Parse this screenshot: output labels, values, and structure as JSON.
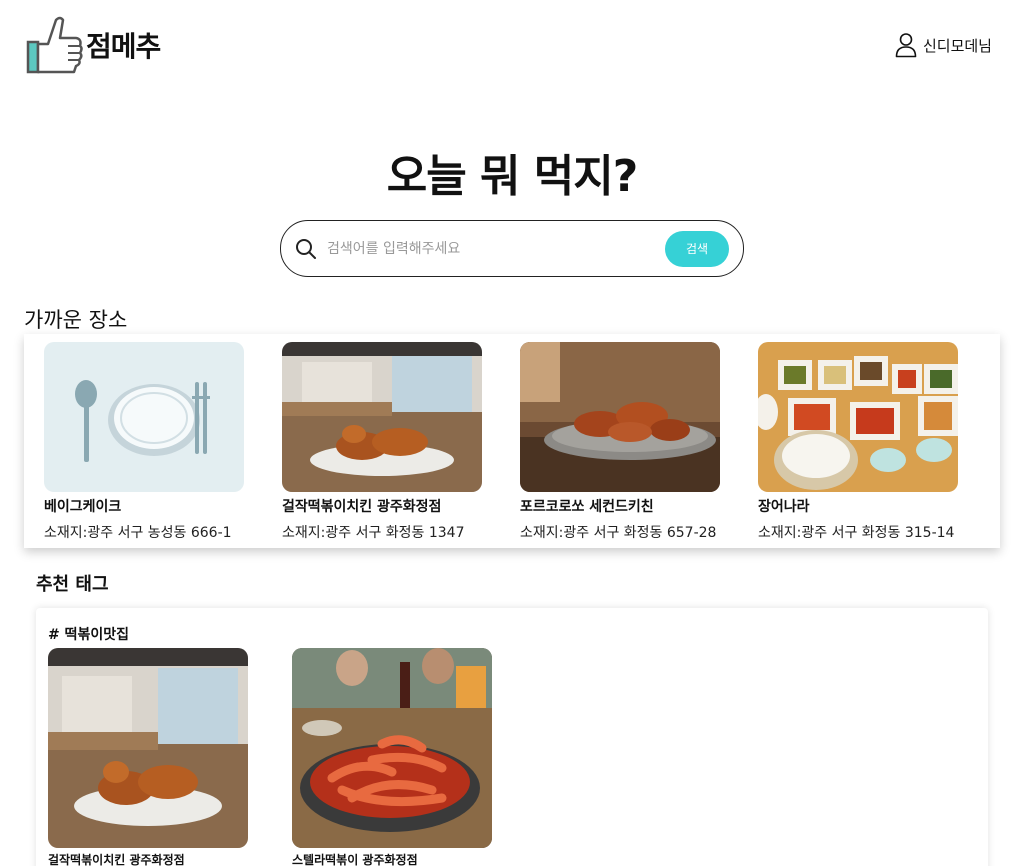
{
  "header": {
    "logo_text": "점메추",
    "user_name": "신디모데님"
  },
  "hero": {
    "title": "오늘 뭐 먹지?"
  },
  "search": {
    "placeholder": "검색어를 입력해주세요",
    "button_label": "검색"
  },
  "nearby": {
    "title": "가까운 장소",
    "places": [
      {
        "name": "베이그케이크",
        "address": "소재지:광주 서구 농성동 666-1",
        "image": "plate-utensils-icon"
      },
      {
        "name": "걸작떡볶이치킨 광주화정점",
        "address": "소재지:광주 서구 화정동 1347",
        "image": "fried-chicken-photo"
      },
      {
        "name": "포르코로쏘 세컨드키친",
        "address": "소재지:광주 서구 화정동 657-28",
        "image": "fried-chicken-photo"
      },
      {
        "name": "장어나라",
        "address": "소재지:광주 서구 화정동 315-14",
        "image": "korean-side-dishes-photo"
      }
    ]
  },
  "tags": {
    "title": "추천 태그",
    "groups": [
      {
        "name": "# 떡볶이맛집",
        "places": [
          {
            "name": "걸작떡볶이치킨 광주화정점",
            "image": "fried-chicken-photo"
          },
          {
            "name": "스텔라떡볶이 광주화정점",
            "image": "tteokbokki-photo"
          }
        ]
      }
    ]
  },
  "colors": {
    "accent": "#36d1d6",
    "logo_thumb": "#5cc8c0",
    "text": "#111111"
  }
}
